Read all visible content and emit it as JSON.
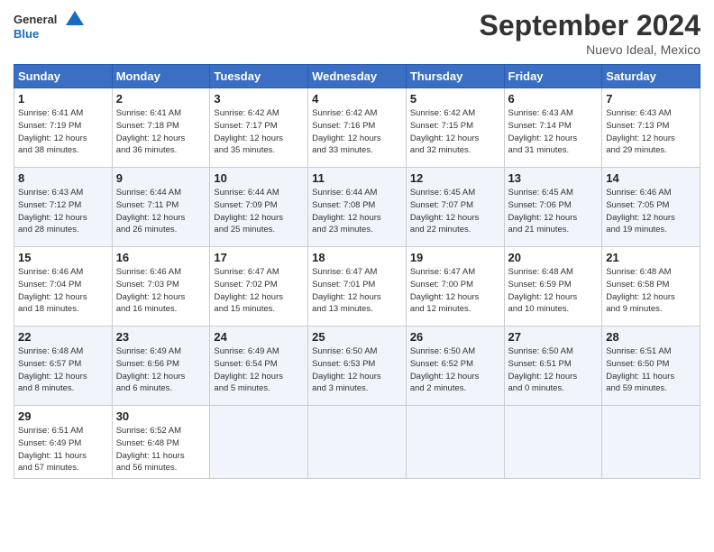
{
  "header": {
    "logo_line1": "General",
    "logo_line2": "Blue",
    "month_title": "September 2024",
    "location": "Nuevo Ideal, Mexico"
  },
  "days_of_week": [
    "Sunday",
    "Monday",
    "Tuesday",
    "Wednesday",
    "Thursday",
    "Friday",
    "Saturday"
  ],
  "weeks": [
    [
      {
        "day": "1",
        "info": "Sunrise: 6:41 AM\nSunset: 7:19 PM\nDaylight: 12 hours\nand 38 minutes."
      },
      {
        "day": "2",
        "info": "Sunrise: 6:41 AM\nSunset: 7:18 PM\nDaylight: 12 hours\nand 36 minutes."
      },
      {
        "day": "3",
        "info": "Sunrise: 6:42 AM\nSunset: 7:17 PM\nDaylight: 12 hours\nand 35 minutes."
      },
      {
        "day": "4",
        "info": "Sunrise: 6:42 AM\nSunset: 7:16 PM\nDaylight: 12 hours\nand 33 minutes."
      },
      {
        "day": "5",
        "info": "Sunrise: 6:42 AM\nSunset: 7:15 PM\nDaylight: 12 hours\nand 32 minutes."
      },
      {
        "day": "6",
        "info": "Sunrise: 6:43 AM\nSunset: 7:14 PM\nDaylight: 12 hours\nand 31 minutes."
      },
      {
        "day": "7",
        "info": "Sunrise: 6:43 AM\nSunset: 7:13 PM\nDaylight: 12 hours\nand 29 minutes."
      }
    ],
    [
      {
        "day": "8",
        "info": "Sunrise: 6:43 AM\nSunset: 7:12 PM\nDaylight: 12 hours\nand 28 minutes."
      },
      {
        "day": "9",
        "info": "Sunrise: 6:44 AM\nSunset: 7:11 PM\nDaylight: 12 hours\nand 26 minutes."
      },
      {
        "day": "10",
        "info": "Sunrise: 6:44 AM\nSunset: 7:09 PM\nDaylight: 12 hours\nand 25 minutes."
      },
      {
        "day": "11",
        "info": "Sunrise: 6:44 AM\nSunset: 7:08 PM\nDaylight: 12 hours\nand 23 minutes."
      },
      {
        "day": "12",
        "info": "Sunrise: 6:45 AM\nSunset: 7:07 PM\nDaylight: 12 hours\nand 22 minutes."
      },
      {
        "day": "13",
        "info": "Sunrise: 6:45 AM\nSunset: 7:06 PM\nDaylight: 12 hours\nand 21 minutes."
      },
      {
        "day": "14",
        "info": "Sunrise: 6:46 AM\nSunset: 7:05 PM\nDaylight: 12 hours\nand 19 minutes."
      }
    ],
    [
      {
        "day": "15",
        "info": "Sunrise: 6:46 AM\nSunset: 7:04 PM\nDaylight: 12 hours\nand 18 minutes."
      },
      {
        "day": "16",
        "info": "Sunrise: 6:46 AM\nSunset: 7:03 PM\nDaylight: 12 hours\nand 16 minutes."
      },
      {
        "day": "17",
        "info": "Sunrise: 6:47 AM\nSunset: 7:02 PM\nDaylight: 12 hours\nand 15 minutes."
      },
      {
        "day": "18",
        "info": "Sunrise: 6:47 AM\nSunset: 7:01 PM\nDaylight: 12 hours\nand 13 minutes."
      },
      {
        "day": "19",
        "info": "Sunrise: 6:47 AM\nSunset: 7:00 PM\nDaylight: 12 hours\nand 12 minutes."
      },
      {
        "day": "20",
        "info": "Sunrise: 6:48 AM\nSunset: 6:59 PM\nDaylight: 12 hours\nand 10 minutes."
      },
      {
        "day": "21",
        "info": "Sunrise: 6:48 AM\nSunset: 6:58 PM\nDaylight: 12 hours\nand 9 minutes."
      }
    ],
    [
      {
        "day": "22",
        "info": "Sunrise: 6:48 AM\nSunset: 6:57 PM\nDaylight: 12 hours\nand 8 minutes."
      },
      {
        "day": "23",
        "info": "Sunrise: 6:49 AM\nSunset: 6:56 PM\nDaylight: 12 hours\nand 6 minutes."
      },
      {
        "day": "24",
        "info": "Sunrise: 6:49 AM\nSunset: 6:54 PM\nDaylight: 12 hours\nand 5 minutes."
      },
      {
        "day": "25",
        "info": "Sunrise: 6:50 AM\nSunset: 6:53 PM\nDaylight: 12 hours\nand 3 minutes."
      },
      {
        "day": "26",
        "info": "Sunrise: 6:50 AM\nSunset: 6:52 PM\nDaylight: 12 hours\nand 2 minutes."
      },
      {
        "day": "27",
        "info": "Sunrise: 6:50 AM\nSunset: 6:51 PM\nDaylight: 12 hours\nand 0 minutes."
      },
      {
        "day": "28",
        "info": "Sunrise: 6:51 AM\nSunset: 6:50 PM\nDaylight: 11 hours\nand 59 minutes."
      }
    ],
    [
      {
        "day": "29",
        "info": "Sunrise: 6:51 AM\nSunset: 6:49 PM\nDaylight: 11 hours\nand 57 minutes."
      },
      {
        "day": "30",
        "info": "Sunrise: 6:52 AM\nSunset: 6:48 PM\nDaylight: 11 hours\nand 56 minutes."
      },
      {
        "day": "",
        "info": ""
      },
      {
        "day": "",
        "info": ""
      },
      {
        "day": "",
        "info": ""
      },
      {
        "day": "",
        "info": ""
      },
      {
        "day": "",
        "info": ""
      }
    ]
  ]
}
